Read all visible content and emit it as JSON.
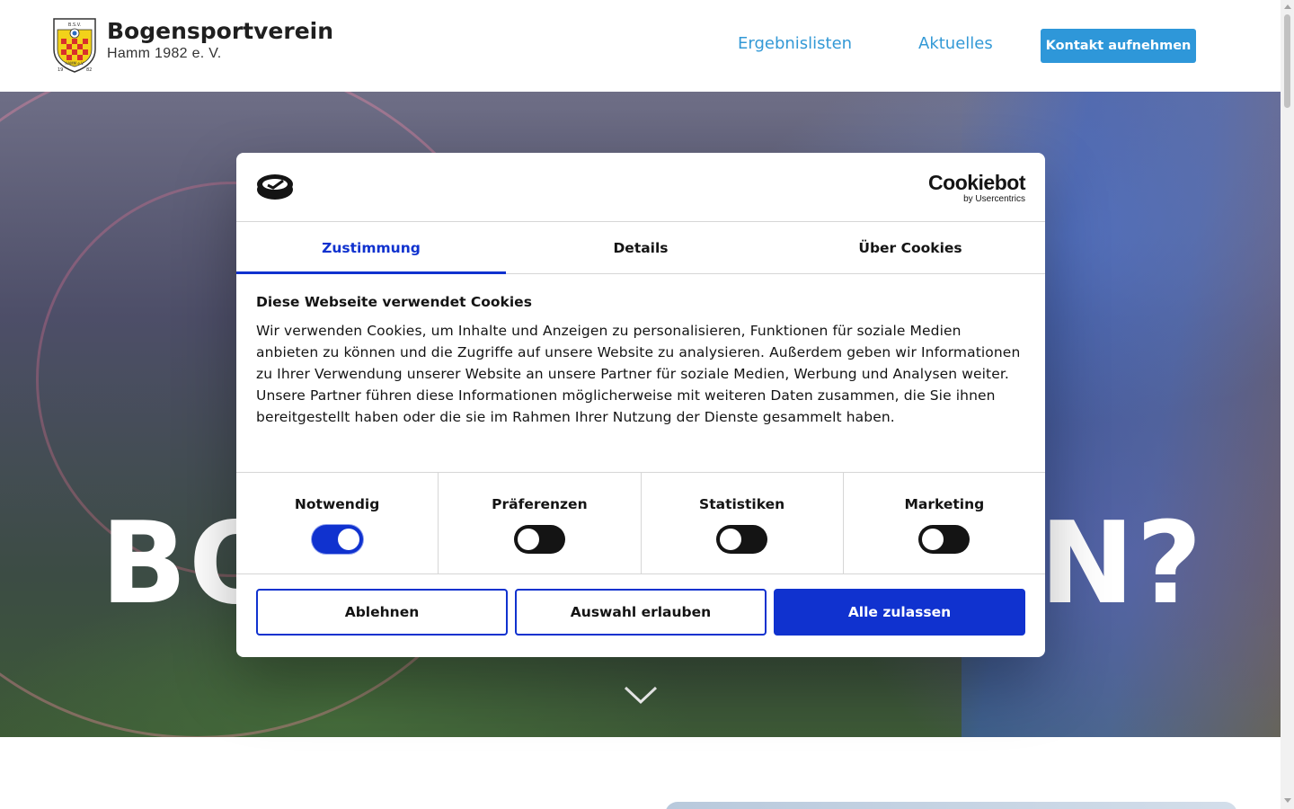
{
  "header": {
    "brand_name": "Bogensportverein",
    "brand_sub": "Hamm 1982 e. V.",
    "nav": [
      {
        "label": "Ergebnislisten"
      },
      {
        "label": "Aktuelles"
      }
    ],
    "cta_label": "Kontakt aufnehmen",
    "accent_color": "#2e97d9",
    "logo_text": {
      "top": "B.S.V.",
      "bottom": "HAMM e.V.",
      "year_left": "19",
      "year_right": "82"
    }
  },
  "hero": {
    "headline_left_visible": "BO",
    "headline_right_visible": "N?",
    "scroll_icon": "chevron-down-icon"
  },
  "cookie_dialog": {
    "brand_main": "Cookiebot",
    "brand_sub": "by Usercentrics",
    "tabs": [
      {
        "label": "Zustimmung",
        "active": true
      },
      {
        "label": "Details",
        "active": false
      },
      {
        "label": "Über Cookies",
        "active": false
      }
    ],
    "title": "Diese Webseite verwendet Cookies",
    "body": "Wir verwenden Cookies, um Inhalte und Anzeigen zu personalisieren, Funktionen für soziale Medien anbieten zu können und die Zugriffe auf unsere Website zu analysieren. Außerdem geben wir Informationen zu Ihrer Verwendung unserer Website an unsere Partner für soziale Medien, Werbung und Analysen weiter. Unsere Partner führen diese Informationen möglicherweise mit weiteren Daten zusammen, die Sie ihnen bereitgestellt haben oder die sie im Rahmen Ihrer Nutzung der Dienste gesammelt haben.",
    "toggles": [
      {
        "label": "Notwendig",
        "on": true
      },
      {
        "label": "Präferenzen",
        "on": false
      },
      {
        "label": "Statistiken",
        "on": false
      },
      {
        "label": "Marketing",
        "on": false
      }
    ],
    "buttons": {
      "decline": "Ablehnen",
      "allow_selection": "Auswahl erlauben",
      "allow_all": "Alle zulassen"
    },
    "accent_color": "#1032cf"
  }
}
